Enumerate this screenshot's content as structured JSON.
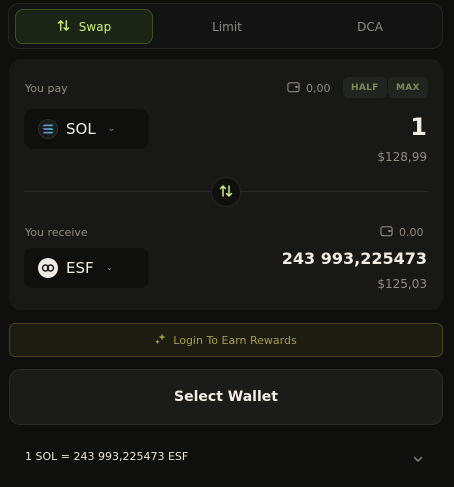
{
  "tabs": [
    {
      "label": "Swap",
      "active": true,
      "icon": "swap-arrows-icon"
    },
    {
      "label": "Limit",
      "active": false
    },
    {
      "label": "DCA",
      "active": false
    }
  ],
  "pay": {
    "label": "You pay",
    "balance": "0,00",
    "half_label": "HALF",
    "max_label": "MAX",
    "token": "SOL",
    "amount": "1",
    "usd_value": "$128,99"
  },
  "receive": {
    "label": "You receive",
    "balance": "0.00",
    "token": "ESF",
    "amount": "243 993,225473",
    "usd_value": "$125,03"
  },
  "rewards": {
    "label": "Login To Earn Rewards"
  },
  "wallet": {
    "label": "Select Wallet"
  },
  "rate": {
    "text": "1 SOL = 243 993,225473 ESF"
  },
  "colors": {
    "background": "#0f0f0e",
    "card": "#181816",
    "accent": "#c8f078",
    "rewards_gold": "#a89c4c"
  }
}
